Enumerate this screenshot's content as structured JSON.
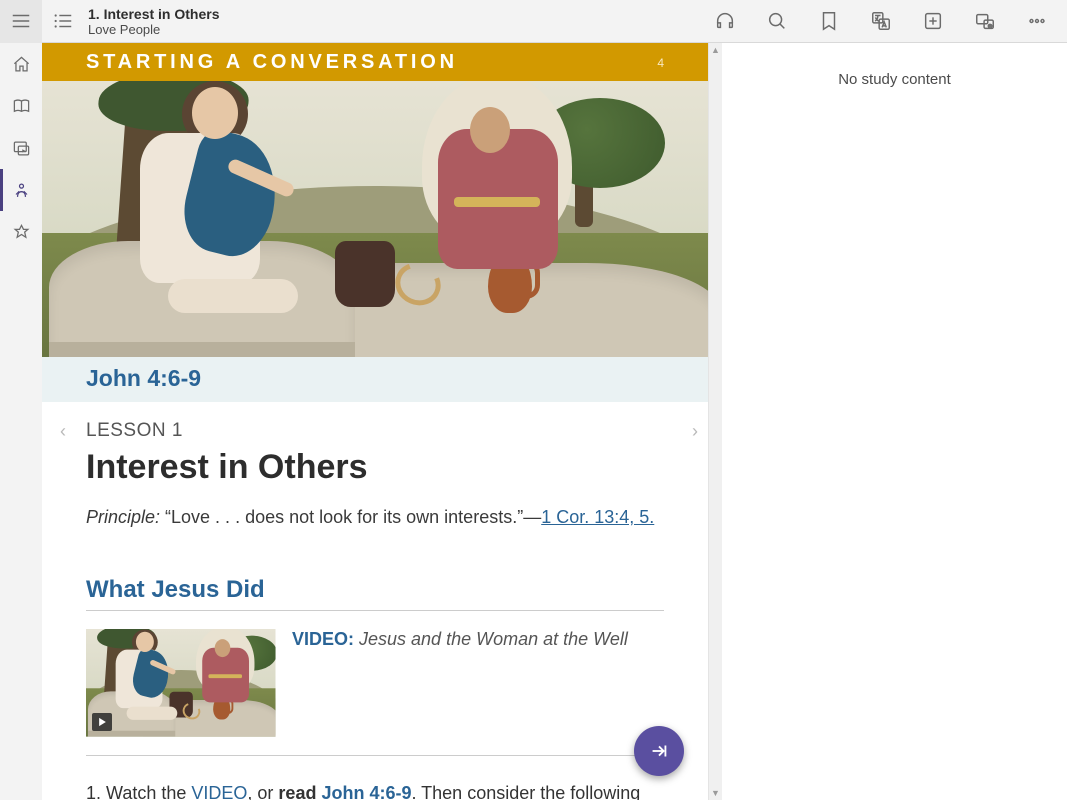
{
  "header": {
    "title": "1. Interest in Others",
    "subtitle": "Love People"
  },
  "banner": {
    "title": "STARTING A CONVERSATION",
    "page": "4"
  },
  "scripture_ref": "John 4:6-9",
  "article": {
    "kicker": "LESSON 1",
    "heading": "Interest in Others",
    "principle_label": "Principle:",
    "principle_quote": " “Love . . . does not look for its own interests.”—",
    "principle_ref": "1 Cor. 13:4, 5.",
    "section_heading": "What Jesus Did",
    "video_label": "VIDEO:",
    "video_title": " Jesus and the Woman at the Well",
    "para_pre": "1. Watch the ",
    "para_link1": "VIDEO",
    "para_mid1": ", or ",
    "para_bold": "read ",
    "para_link2": "John 4:6-9",
    "para_post": ". Then consider the following"
  },
  "study_pane": {
    "empty_message": "No study content"
  }
}
